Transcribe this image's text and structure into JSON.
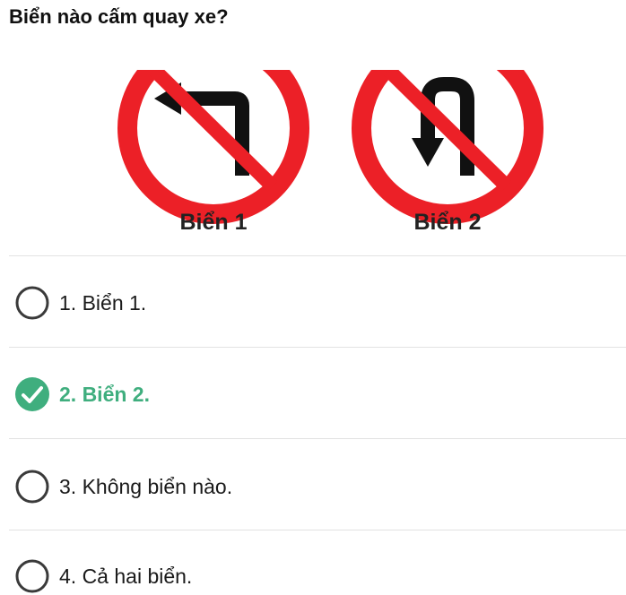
{
  "question": {
    "text": "Biển nào cấm quay xe?"
  },
  "signs": [
    {
      "caption": "Biển 1",
      "icon": "no-left-turn-icon"
    },
    {
      "caption": "Biển 2",
      "icon": "no-u-turn-icon"
    }
  ],
  "options": [
    {
      "label": "1. Biển 1.",
      "state": "unselected"
    },
    {
      "label": "2. Biển 2.",
      "state": "correct"
    },
    {
      "label": "3. Không biển nào.",
      "state": "unselected"
    },
    {
      "label": "4. Cả hai biển.",
      "state": "unselected"
    }
  ],
  "colors": {
    "sign_red": "#ec2027",
    "correct_green": "#3fae7e",
    "radio_gray": "#3a3a3a",
    "divider": "#e2e2e2"
  }
}
